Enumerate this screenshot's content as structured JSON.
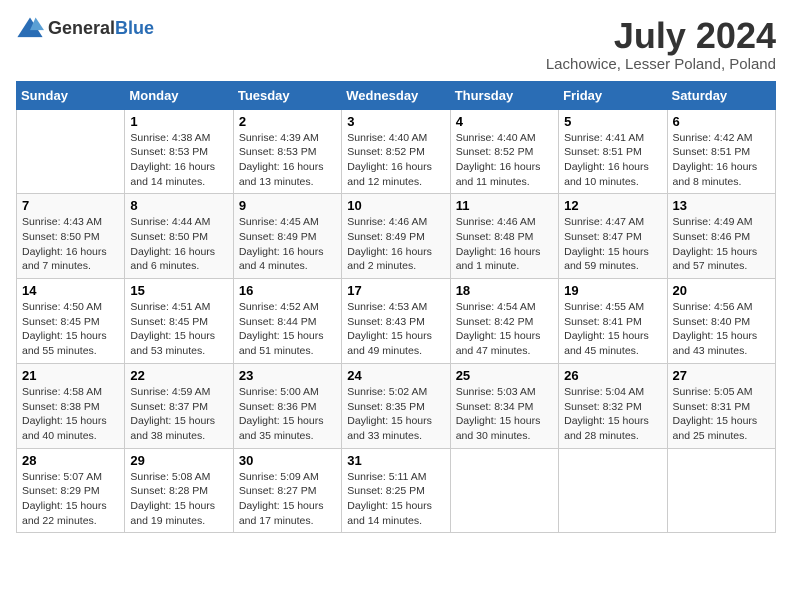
{
  "header": {
    "logo_general": "General",
    "logo_blue": "Blue",
    "title": "July 2024",
    "subtitle": "Lachowice, Lesser Poland, Poland"
  },
  "days_of_week": [
    "Sunday",
    "Monday",
    "Tuesday",
    "Wednesday",
    "Thursday",
    "Friday",
    "Saturday"
  ],
  "weeks": [
    [
      {
        "day": "",
        "info": ""
      },
      {
        "day": "1",
        "info": "Sunrise: 4:38 AM\nSunset: 8:53 PM\nDaylight: 16 hours\nand 14 minutes."
      },
      {
        "day": "2",
        "info": "Sunrise: 4:39 AM\nSunset: 8:53 PM\nDaylight: 16 hours\nand 13 minutes."
      },
      {
        "day": "3",
        "info": "Sunrise: 4:40 AM\nSunset: 8:52 PM\nDaylight: 16 hours\nand 12 minutes."
      },
      {
        "day": "4",
        "info": "Sunrise: 4:40 AM\nSunset: 8:52 PM\nDaylight: 16 hours\nand 11 minutes."
      },
      {
        "day": "5",
        "info": "Sunrise: 4:41 AM\nSunset: 8:51 PM\nDaylight: 16 hours\nand 10 minutes."
      },
      {
        "day": "6",
        "info": "Sunrise: 4:42 AM\nSunset: 8:51 PM\nDaylight: 16 hours\nand 8 minutes."
      }
    ],
    [
      {
        "day": "7",
        "info": "Sunrise: 4:43 AM\nSunset: 8:50 PM\nDaylight: 16 hours\nand 7 minutes."
      },
      {
        "day": "8",
        "info": "Sunrise: 4:44 AM\nSunset: 8:50 PM\nDaylight: 16 hours\nand 6 minutes."
      },
      {
        "day": "9",
        "info": "Sunrise: 4:45 AM\nSunset: 8:49 PM\nDaylight: 16 hours\nand 4 minutes."
      },
      {
        "day": "10",
        "info": "Sunrise: 4:46 AM\nSunset: 8:49 PM\nDaylight: 16 hours\nand 2 minutes."
      },
      {
        "day": "11",
        "info": "Sunrise: 4:46 AM\nSunset: 8:48 PM\nDaylight: 16 hours\nand 1 minute."
      },
      {
        "day": "12",
        "info": "Sunrise: 4:47 AM\nSunset: 8:47 PM\nDaylight: 15 hours\nand 59 minutes."
      },
      {
        "day": "13",
        "info": "Sunrise: 4:49 AM\nSunset: 8:46 PM\nDaylight: 15 hours\nand 57 minutes."
      }
    ],
    [
      {
        "day": "14",
        "info": "Sunrise: 4:50 AM\nSunset: 8:45 PM\nDaylight: 15 hours\nand 55 minutes."
      },
      {
        "day": "15",
        "info": "Sunrise: 4:51 AM\nSunset: 8:45 PM\nDaylight: 15 hours\nand 53 minutes."
      },
      {
        "day": "16",
        "info": "Sunrise: 4:52 AM\nSunset: 8:44 PM\nDaylight: 15 hours\nand 51 minutes."
      },
      {
        "day": "17",
        "info": "Sunrise: 4:53 AM\nSunset: 8:43 PM\nDaylight: 15 hours\nand 49 minutes."
      },
      {
        "day": "18",
        "info": "Sunrise: 4:54 AM\nSunset: 8:42 PM\nDaylight: 15 hours\nand 47 minutes."
      },
      {
        "day": "19",
        "info": "Sunrise: 4:55 AM\nSunset: 8:41 PM\nDaylight: 15 hours\nand 45 minutes."
      },
      {
        "day": "20",
        "info": "Sunrise: 4:56 AM\nSunset: 8:40 PM\nDaylight: 15 hours\nand 43 minutes."
      }
    ],
    [
      {
        "day": "21",
        "info": "Sunrise: 4:58 AM\nSunset: 8:38 PM\nDaylight: 15 hours\nand 40 minutes."
      },
      {
        "day": "22",
        "info": "Sunrise: 4:59 AM\nSunset: 8:37 PM\nDaylight: 15 hours\nand 38 minutes."
      },
      {
        "day": "23",
        "info": "Sunrise: 5:00 AM\nSunset: 8:36 PM\nDaylight: 15 hours\nand 35 minutes."
      },
      {
        "day": "24",
        "info": "Sunrise: 5:02 AM\nSunset: 8:35 PM\nDaylight: 15 hours\nand 33 minutes."
      },
      {
        "day": "25",
        "info": "Sunrise: 5:03 AM\nSunset: 8:34 PM\nDaylight: 15 hours\nand 30 minutes."
      },
      {
        "day": "26",
        "info": "Sunrise: 5:04 AM\nSunset: 8:32 PM\nDaylight: 15 hours\nand 28 minutes."
      },
      {
        "day": "27",
        "info": "Sunrise: 5:05 AM\nSunset: 8:31 PM\nDaylight: 15 hours\nand 25 minutes."
      }
    ],
    [
      {
        "day": "28",
        "info": "Sunrise: 5:07 AM\nSunset: 8:29 PM\nDaylight: 15 hours\nand 22 minutes."
      },
      {
        "day": "29",
        "info": "Sunrise: 5:08 AM\nSunset: 8:28 PM\nDaylight: 15 hours\nand 19 minutes."
      },
      {
        "day": "30",
        "info": "Sunrise: 5:09 AM\nSunset: 8:27 PM\nDaylight: 15 hours\nand 17 minutes."
      },
      {
        "day": "31",
        "info": "Sunrise: 5:11 AM\nSunset: 8:25 PM\nDaylight: 15 hours\nand 14 minutes."
      },
      {
        "day": "",
        "info": ""
      },
      {
        "day": "",
        "info": ""
      },
      {
        "day": "",
        "info": ""
      }
    ]
  ]
}
